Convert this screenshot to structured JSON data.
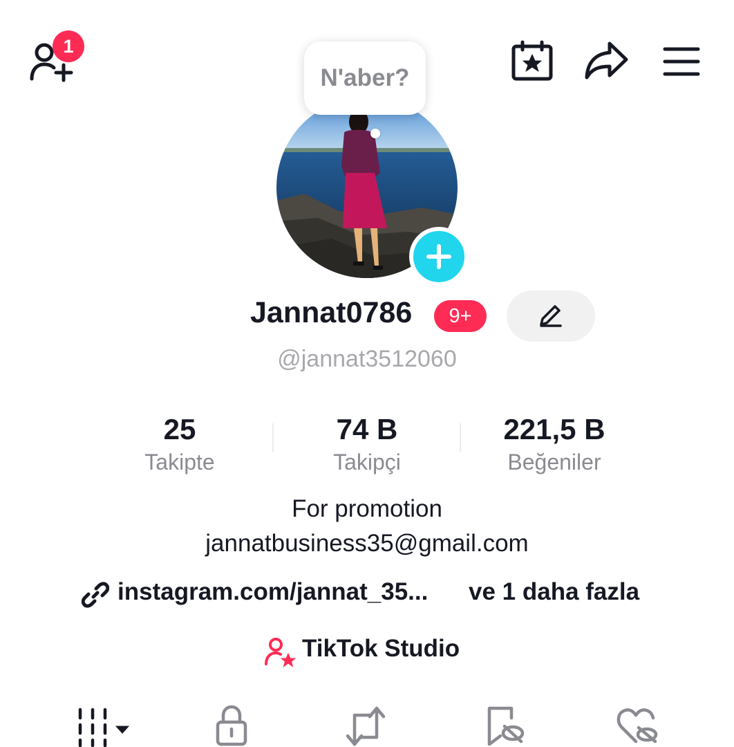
{
  "header": {
    "add_friends_badge": "1",
    "icons": [
      "add-friend-icon",
      "calendar-star-icon",
      "share-icon",
      "menu-icon"
    ]
  },
  "note_bubble": {
    "text": "N'aber?"
  },
  "profile": {
    "display_name": "Jannat0786",
    "level_badge": "9+",
    "handle": "@jannat3512060"
  },
  "stats": [
    {
      "value": "25",
      "label": "Takipte"
    },
    {
      "value": "74 B",
      "label": "Takipçi"
    },
    {
      "value": "221,5 B",
      "label": "Beğeniler"
    }
  ],
  "bio": {
    "line1": "For promotion",
    "line2": "jannatbusiness35@gmail.com"
  },
  "links": {
    "primary": "instagram.com/jannat_35...",
    "more": "ve 1 daha fazla"
  },
  "studio": {
    "label": "TikTok Studio"
  },
  "tabs": [
    "grid-icon",
    "lock-icon",
    "repost-icon",
    "bookmark-hidden-icon",
    "heart-hidden-icon"
  ],
  "colors": {
    "accent": "#fe2c55",
    "add_button": "#20d5ec",
    "text": "#161823",
    "muted": "#8a8b91"
  }
}
